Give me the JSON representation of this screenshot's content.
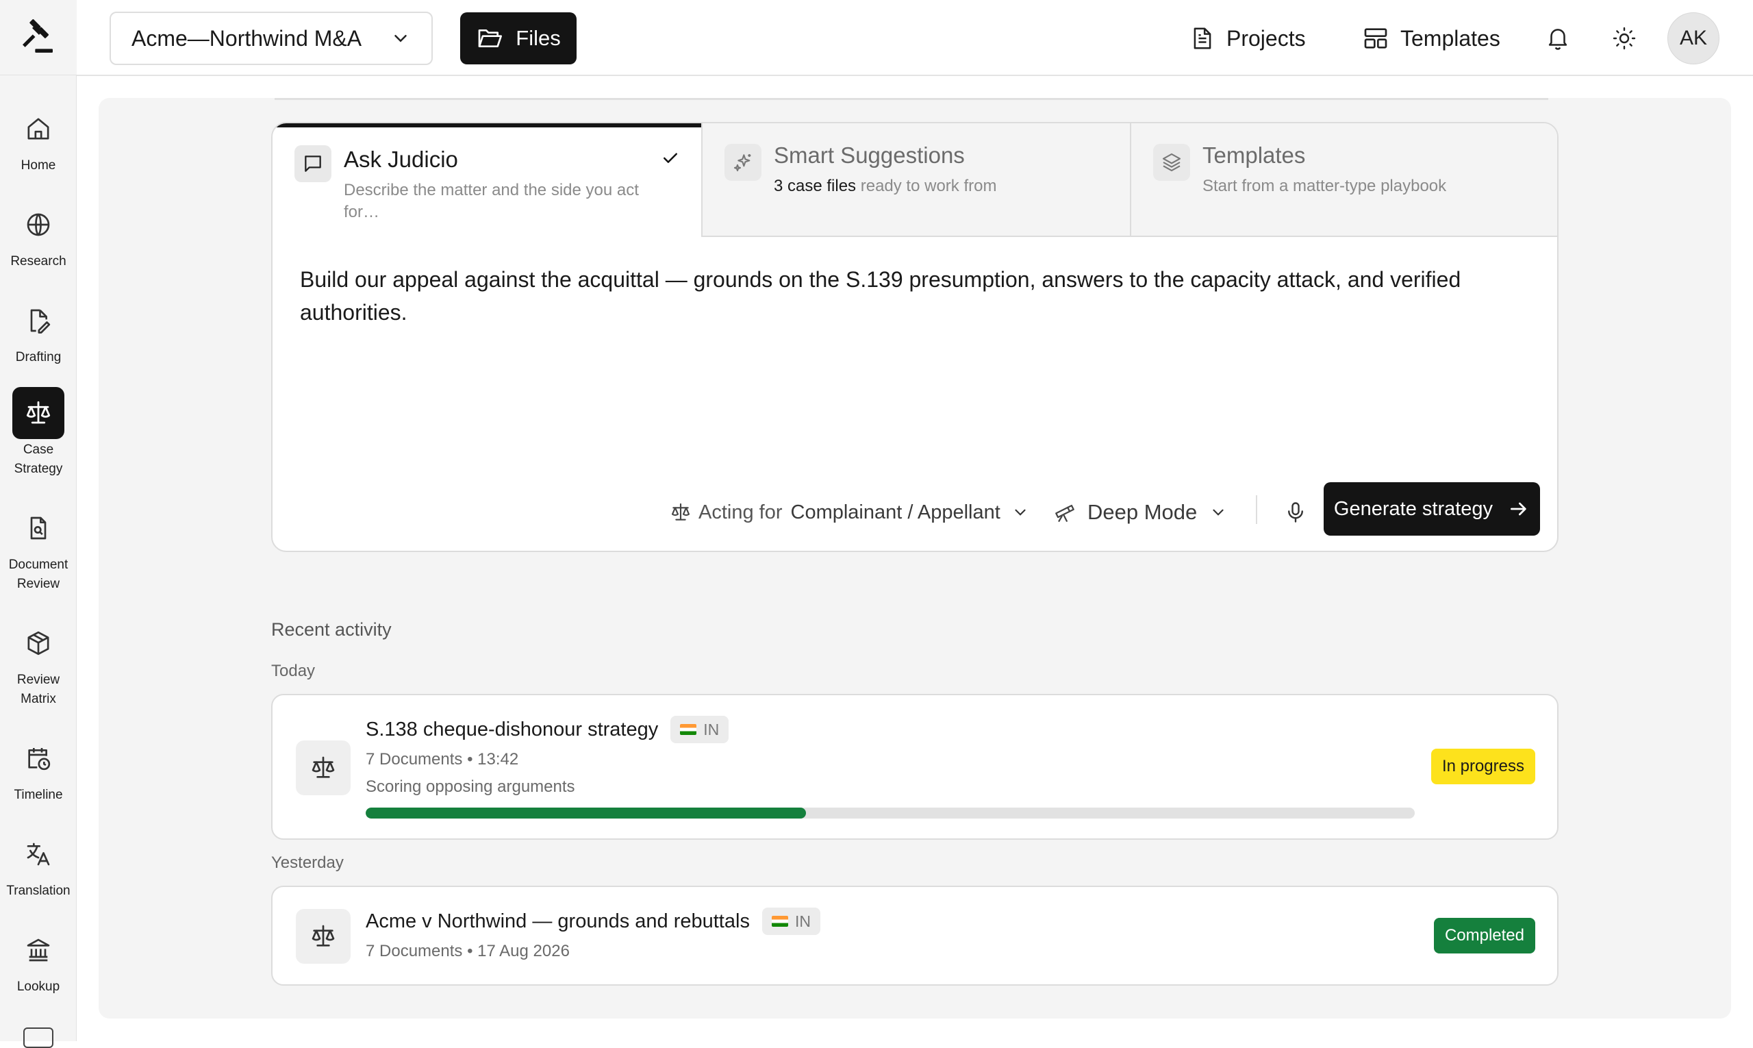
{
  "app": {
    "logo_icon": "gavel-icon"
  },
  "sidebar": {
    "items": [
      {
        "label": "Home",
        "icon": "home-icon",
        "active": false
      },
      {
        "label": "Research",
        "icon": "globe-icon",
        "active": false
      },
      {
        "label": "Drafting",
        "icon": "file-pen-icon",
        "active": false
      },
      {
        "label": "Case\nStrategy",
        "icon": "scales-icon",
        "active": true
      },
      {
        "label": "Document\nReview",
        "icon": "file-search-icon",
        "active": false
      },
      {
        "label": "Review\nMatrix",
        "icon": "cube-icon",
        "active": false
      },
      {
        "label": "Timeline",
        "icon": "calendar-clock-icon",
        "active": false
      },
      {
        "label": "Translation",
        "icon": "languages-icon",
        "active": false
      },
      {
        "label": "Lookup",
        "icon": "landmark-icon",
        "active": false
      }
    ]
  },
  "header": {
    "project": "Acme—Northwind M&A",
    "files_label": "Files",
    "projects_label": "Projects",
    "templates_label": "Templates",
    "avatar_initials": "AK"
  },
  "composer": {
    "tabs": [
      {
        "title": "Ask Judicio",
        "subtitle": "Describe the matter and the side you act for…"
      },
      {
        "title": "Smart Suggestions",
        "subtitle_bold": "3 case files",
        "subtitle_rest": " ready to work from"
      },
      {
        "title": "Templates",
        "subtitle": "Start from a matter-type playbook"
      }
    ],
    "prompt": "Build our appeal against the acquittal — grounds on the S.139 presumption, answers to the capacity attack, and verified authorities.",
    "acting_for_label": "Acting for",
    "acting_for_value": "Complainant / Appellant",
    "mode": "Deep Mode",
    "generate_label": "Generate strategy"
  },
  "activity": {
    "title": "Recent activity",
    "groups": [
      {
        "day": "Today",
        "items": [
          {
            "title": "S.138 cheque-dishonour strategy",
            "country": "IN",
            "meta": "7 Documents • 13:42",
            "status_text": "Scoring opposing arguments",
            "progress": 0.42,
            "badge": "In progress",
            "badge_color": "#fde21c"
          }
        ]
      },
      {
        "day": "Yesterday",
        "items": [
          {
            "title": "Acme v Northwind — grounds and rebuttals",
            "country": "IN",
            "meta": "7 Documents • 17 Aug 2026",
            "badge": "Completed",
            "badge_color": "#15803d"
          }
        ]
      }
    ]
  },
  "colors": {
    "accent": "#141414",
    "success": "#15803d",
    "warning": "#fde21c",
    "surface": "#f4f4f4"
  }
}
